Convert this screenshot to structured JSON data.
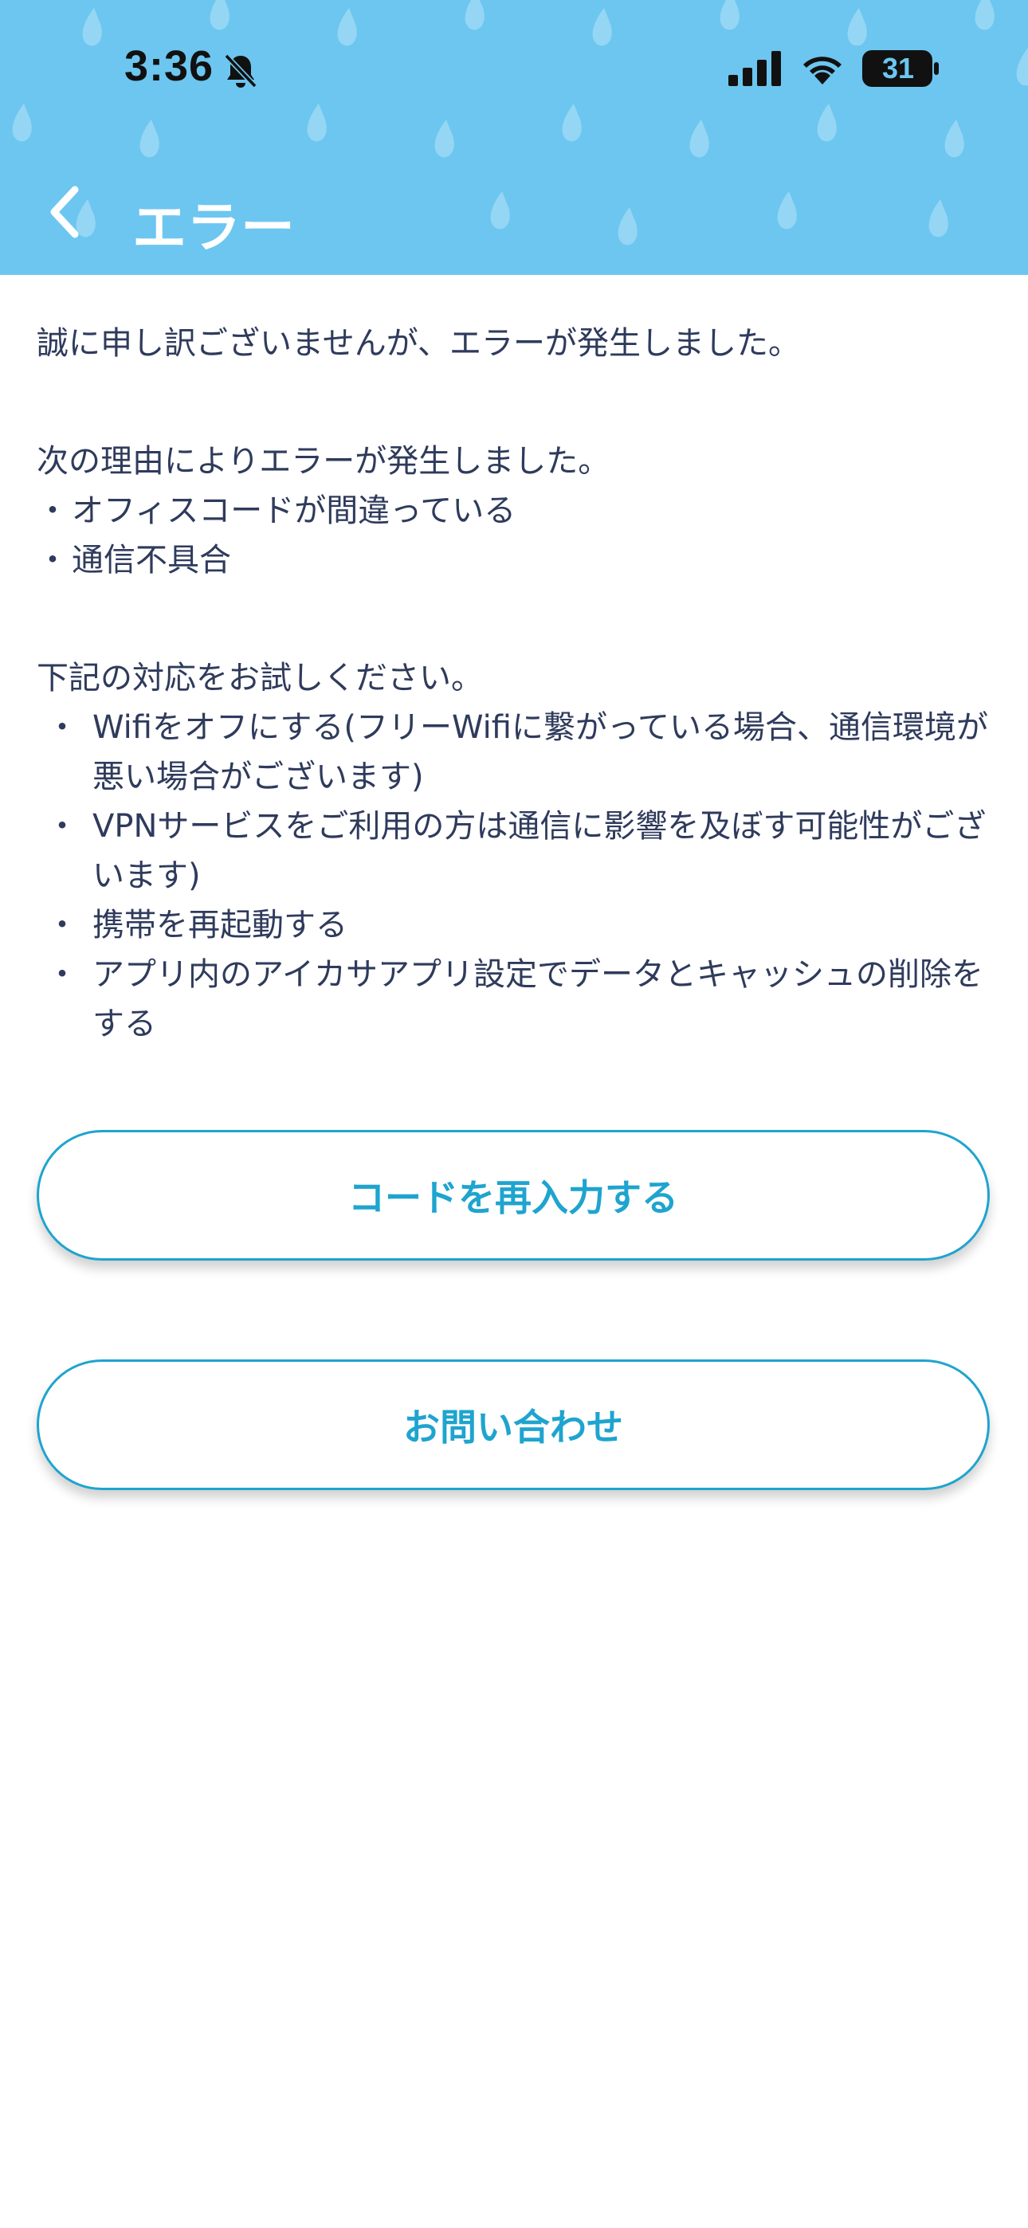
{
  "status_bar": {
    "time": "3:36",
    "battery_level": "31",
    "icons": [
      "bell-slash-icon",
      "cellular-signal-icon",
      "wifi-icon",
      "battery-icon"
    ]
  },
  "header": {
    "title": "エラー",
    "back_icon": "chevron-left-icon",
    "background_color": "#6cc6f0"
  },
  "message": {
    "intro": "誠に申し訳ございませんが、エラーが発生しました。",
    "reasons_heading": "次の理由によりエラーが発生しました。",
    "reasons": [
      "オフィスコードが間違っている",
      "通信不具合"
    ],
    "reason_bullet": "・",
    "actions_heading": "下記の対応をお試しください。",
    "action_bullet": "・",
    "actions": [
      "Wifiをオフにする(フリーWifiに繋がっている場合、通信環境が悪い場合がございます)",
      "VPNサービスをご利用の方は通信に影響を及ぼす可能性がございます)",
      "携帯を再起動する",
      "アプリ内のアイカサアプリ設定でデータとキャッシュの削除をする"
    ]
  },
  "buttons": {
    "retry_label": "コードを再入力する",
    "contact_label": "お問い合わせ",
    "accent_color": "#1ea4cf"
  }
}
